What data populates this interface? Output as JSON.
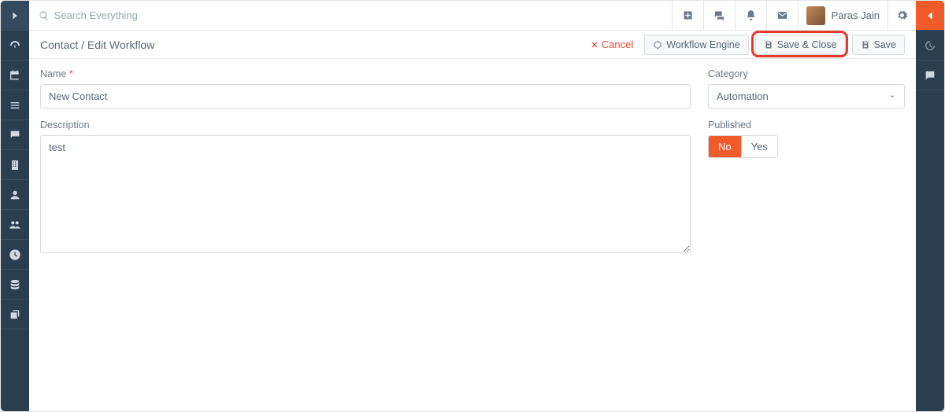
{
  "topbar": {
    "search_placeholder": "Search Everything",
    "user_name": "Paras Jain"
  },
  "subhead": {
    "breadcrumb": "Contact / Edit Workflow",
    "cancel": "Cancel",
    "workflow_engine": "Workflow Engine",
    "save_close": "Save & Close",
    "save": "Save"
  },
  "form": {
    "name_label": "Name",
    "name_value": "New Contact",
    "description_label": "Description",
    "description_value": "test",
    "category_label": "Category",
    "category_value": "Automation",
    "published_label": "Published",
    "published_no": "No",
    "published_yes": "Yes"
  }
}
